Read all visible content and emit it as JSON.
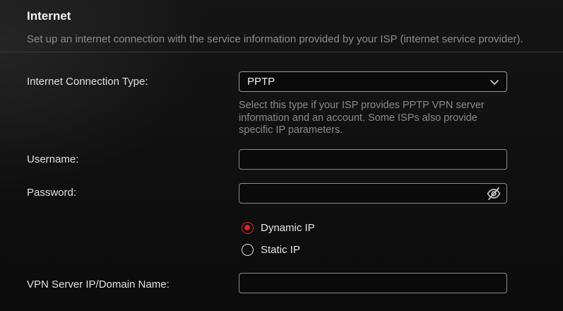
{
  "section": {
    "title": "Internet",
    "description": "Set up an internet connection with the service information provided by your ISP (internet service provider)."
  },
  "connection_type": {
    "label": "Internet Connection Type:",
    "selected": "PPTP",
    "hint": "Select this type if your ISP provides PPTP VPN server information and an account. Some ISPs also provide specific IP parameters."
  },
  "username": {
    "label": "Username:",
    "value": ""
  },
  "password": {
    "label": "Password:",
    "value": "",
    "icon": "eye-slash-icon"
  },
  "ip_mode": {
    "options": [
      {
        "label": "Dynamic IP",
        "checked": true
      },
      {
        "label": "Static IP",
        "checked": false
      }
    ]
  },
  "vpn_server": {
    "label": "VPN Server IP/Domain Name:",
    "value": ""
  },
  "colors": {
    "accent": "#d8232a",
    "background": "#0d0d0d",
    "border": "#8a8a8a",
    "muted_text": "#8a8a8a"
  }
}
